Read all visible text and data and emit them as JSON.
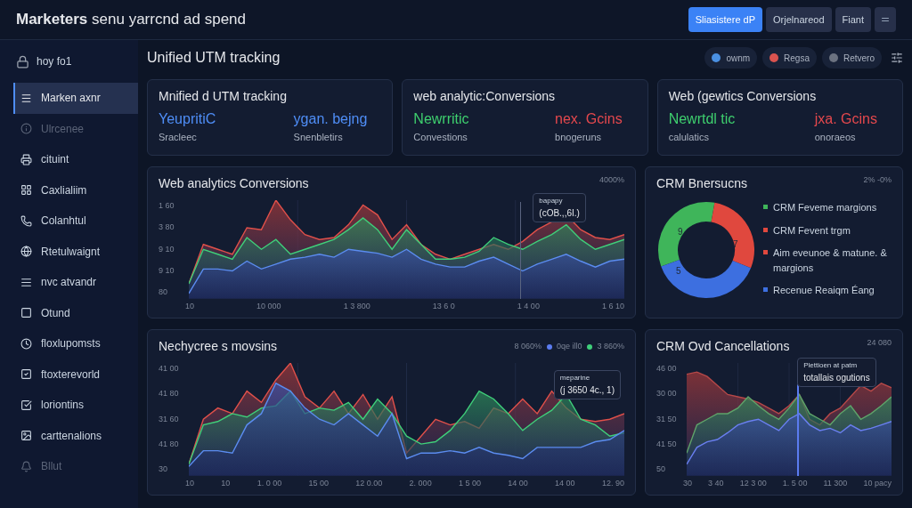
{
  "header": {
    "title": "**Marketers** senu yarrcnd ad spend",
    "buttons": [
      {
        "label": "Sliasistere dP",
        "kind": "primary"
      },
      {
        "label": "Orjelnareod",
        "kind": "secondary"
      },
      {
        "label": "Fiant",
        "kind": "secondary"
      },
      {
        "kind": "icon"
      }
    ]
  },
  "sidebar": {
    "brand": "hoy  fo1",
    "items": [
      {
        "label": "Marken axnr",
        "selected": true,
        "disabled": false
      },
      {
        "label": "Ulrcenee",
        "selected": false,
        "disabled": true
      },
      {
        "label": "cituint",
        "selected": false,
        "disabled": false
      },
      {
        "label": "Caxlialiim",
        "selected": false,
        "disabled": false
      },
      {
        "label": "Colanhtul",
        "selected": false,
        "disabled": false
      },
      {
        "label": "Rtetulwaignt",
        "selected": false,
        "disabled": false
      },
      {
        "label": "nvc atvandr",
        "selected": false,
        "disabled": false
      },
      {
        "label": "Otund",
        "selected": false,
        "disabled": false
      },
      {
        "label": "floxlupomsts",
        "selected": false,
        "disabled": false
      },
      {
        "label": "ftoxterevorld",
        "selected": false,
        "disabled": false
      },
      {
        "label": "loriontins",
        "selected": false,
        "disabled": false
      },
      {
        "label": "carttenalions",
        "selected": false,
        "disabled": false
      },
      {
        "label": "Bllut",
        "selected": false,
        "disabled": true
      }
    ]
  },
  "page": {
    "heading": "Unified UTM tracking",
    "filters": [
      {
        "label": "ownm",
        "color": "#4a90e2"
      },
      {
        "label": "Regsa",
        "color": "#d9534f"
      },
      {
        "label": "Retvero",
        "color": "#6b7280"
      }
    ]
  },
  "kpi_cards": [
    {
      "title": "Mnified d UTM tracking",
      "values": [
        {
          "value": "YeupritiC",
          "caption": "Sracleec",
          "color": "#4f8ef7"
        },
        {
          "value": "ygan. bejng",
          "caption": "Snenbletirs",
          "color": "#4f8ef7"
        }
      ]
    },
    {
      "title": "web analytic:Conversions",
      "values": [
        {
          "value": "Newrritic",
          "caption": "Convestions",
          "color": "#3ecf6e"
        },
        {
          "value": "nex. Gcins",
          "caption": "bnogeruns",
          "color": "#e5484d"
        }
      ]
    },
    {
      "title": "Web (gewtics Conversions",
      "values": [
        {
          "value": "Newrtdl tic",
          "caption": "calulatics",
          "color": "#3ecf6e"
        },
        {
          "value": "jxa. Gcins",
          "caption": "onoraeos",
          "color": "#e5484d"
        }
      ]
    }
  ],
  "traffic_chart": {
    "title": "Web analytics Conversions",
    "corner": "4000%",
    "y_labels": [
      "1 60",
      "3 80",
      "9 10",
      "9 10",
      "80"
    ],
    "x_labels": [
      "10",
      "10 000",
      "1 3 800",
      "13 6 0",
      "1 4 00",
      "1 6 10"
    ],
    "tooltip": [
      "bapapy",
      "(cOB.,,6I.)"
    ]
  },
  "crm_donut": {
    "title": "CRM Bnersucns",
    "corner": "2% -0%",
    "segments": [
      {
        "label": "9",
        "color": "#3fb55a"
      },
      {
        "label": "7",
        "color": "#e0483e"
      },
      {
        "label": "5",
        "color": "#3d6fe0"
      }
    ],
    "legend": [
      {
        "label": "CRM Feveme margions",
        "color": "#3fb55a"
      },
      {
        "label": "CRM Fevent trgm",
        "color": "#e0483e"
      },
      {
        "label": "Aim eveunoe & matune. & margions",
        "color": "#e0483e"
      },
      {
        "label": "Recenue Reaiqm Éang",
        "color": "#3d6fe0"
      }
    ]
  },
  "trend_chart": {
    "title": "Nechycree s movsins",
    "legend": [
      {
        "label": "8 060%"
      },
      {
        "label": "0qe ill0",
        "color": "#5b7cf0"
      },
      {
        "label": "3 860%",
        "color": "#3fcf7a"
      }
    ],
    "y_labels": [
      "41 00",
      "41 80",
      "31 60",
      "41 80",
      "30"
    ],
    "x_labels": [
      "10",
      "10",
      "1. 0 00",
      "15 00",
      "12 0.00",
      "2. 000",
      "1 5 00",
      "14 00",
      "14 00",
      "12. 90"
    ],
    "tooltip": [
      "meparine",
      "(j 3650 4c., 1)"
    ]
  },
  "cancel_chart": {
    "title": "CRM Ovd Cancellations",
    "corner": "24 080",
    "y_labels": [
      "46 00",
      "30 00",
      "31 50",
      "41 50",
      "50"
    ],
    "x_labels": [
      "30",
      "3 40",
      "12 3 00",
      "1. 5 00",
      "11 300",
      "10 pacy"
    ],
    "tooltip": [
      "Plettioen at patm",
      "totallais ogutions"
    ]
  }
}
